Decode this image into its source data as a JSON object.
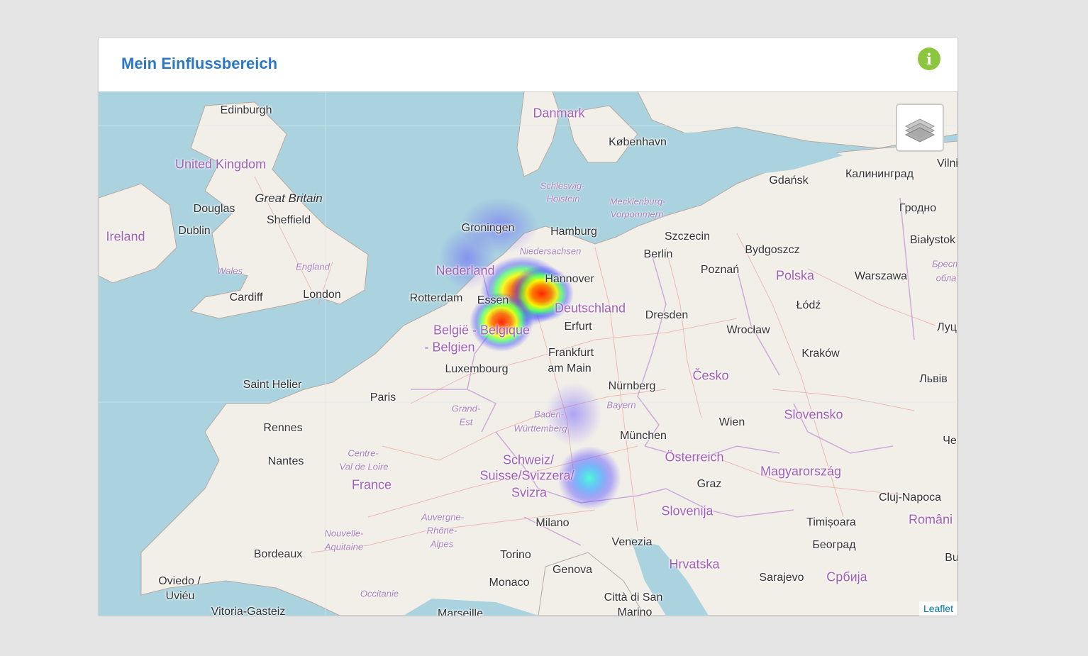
{
  "widget": {
    "title": "Mein Einflussbereich",
    "info_icon": "info-circle-icon",
    "accent_color": "#2b78c5",
    "info_color": "#8cc63f"
  },
  "map": {
    "layers_icon": "layers-icon",
    "attribution": "Leaflet",
    "labels": [
      {
        "name": "label-edinburgh",
        "text": "Edinburgh",
        "kind": "city"
      },
      {
        "name": "label-united-kingdom",
        "text": "United Kingdom",
        "kind": "country"
      },
      {
        "name": "label-great-britain",
        "text": "Great Britain",
        "kind": "island"
      },
      {
        "name": "label-douglas",
        "text": "Douglas",
        "kind": "city"
      },
      {
        "name": "label-sheffield",
        "text": "Sheffield",
        "kind": "city"
      },
      {
        "name": "label-ireland",
        "text": "Ireland",
        "kind": "country"
      },
      {
        "name": "label-dublin",
        "text": "Dublin",
        "kind": "city"
      },
      {
        "name": "label-wales",
        "text": "Wales",
        "kind": "region"
      },
      {
        "name": "label-england",
        "text": "England",
        "kind": "region"
      },
      {
        "name": "label-cardiff",
        "text": "Cardiff",
        "kind": "city"
      },
      {
        "name": "label-london",
        "text": "London",
        "kind": "city"
      },
      {
        "name": "label-danmark",
        "text": "Danmark",
        "kind": "country"
      },
      {
        "name": "label-kobenhavn",
        "text": "København",
        "kind": "city"
      },
      {
        "name": "label-schleswig-holstein-1",
        "text": "Schleswig-",
        "kind": "region"
      },
      {
        "name": "label-schleswig-holstein-2",
        "text": "Holstein",
        "kind": "region"
      },
      {
        "name": "label-mecklenburg-1",
        "text": "Mecklenburg-",
        "kind": "region"
      },
      {
        "name": "label-mecklenburg-2",
        "text": "Vorpommern",
        "kind": "region"
      },
      {
        "name": "label-gdansk",
        "text": "Gdańsk",
        "kind": "city"
      },
      {
        "name": "label-kaliningrad",
        "text": "Калининград",
        "kind": "city"
      },
      {
        "name": "label-vilnius",
        "text": "Vilni",
        "kind": "city"
      },
      {
        "name": "label-groningen",
        "text": "Groningen",
        "kind": "city"
      },
      {
        "name": "label-hamburg",
        "text": "Hamburg",
        "kind": "city"
      },
      {
        "name": "label-szczecin",
        "text": "Szczecin",
        "kind": "city"
      },
      {
        "name": "label-grodno",
        "text": "Гродно",
        "kind": "city"
      },
      {
        "name": "label-bialystok",
        "text": "Białystok",
        "kind": "city"
      },
      {
        "name": "label-niedersachsen",
        "text": "Niedersachsen",
        "kind": "region"
      },
      {
        "name": "label-berlin",
        "text": "Berlin",
        "kind": "city"
      },
      {
        "name": "label-bydgoszcz",
        "text": "Bydgoszcz",
        "kind": "city"
      },
      {
        "name": "label-nederland",
        "text": "Nederland",
        "kind": "country"
      },
      {
        "name": "label-hannover",
        "text": "Hannover",
        "kind": "city"
      },
      {
        "name": "label-poznan",
        "text": "Poznań",
        "kind": "city"
      },
      {
        "name": "label-polska",
        "text": "Polska",
        "kind": "country"
      },
      {
        "name": "label-warszawa",
        "text": "Warszawa",
        "kind": "city"
      },
      {
        "name": "label-brest-1",
        "text": "Брест",
        "kind": "region"
      },
      {
        "name": "label-brest-2",
        "text": "обла",
        "kind": "region"
      },
      {
        "name": "label-rotterdam",
        "text": "Rotterdam",
        "kind": "city"
      },
      {
        "name": "label-essen",
        "text": "Essen",
        "kind": "city"
      },
      {
        "name": "label-deutschland",
        "text": "Deutschland",
        "kind": "country"
      },
      {
        "name": "label-dresden",
        "text": "Dresden",
        "kind": "city"
      },
      {
        "name": "label-lodz",
        "text": "Łódź",
        "kind": "city"
      },
      {
        "name": "label-belgie",
        "text": "België - Belgique",
        "kind": "country"
      },
      {
        "name": "label-belgien",
        "text": "- Belgien",
        "kind": "country"
      },
      {
        "name": "label-erfurt",
        "text": "Erfurt",
        "kind": "city"
      },
      {
        "name": "label-wroclaw",
        "text": "Wrocław",
        "kind": "city"
      },
      {
        "name": "label-lutsk",
        "text": "Луц",
        "kind": "city"
      },
      {
        "name": "label-frankfurt-1",
        "text": "Frankfurt",
        "kind": "city"
      },
      {
        "name": "label-frankfurt-2",
        "text": "am Main",
        "kind": "city"
      },
      {
        "name": "label-krakow",
        "text": "Kraków",
        "kind": "city"
      },
      {
        "name": "label-luxembourg",
        "text": "Luxembourg",
        "kind": "city"
      },
      {
        "name": "label-cesko",
        "text": "Česko",
        "kind": "country"
      },
      {
        "name": "label-lviv",
        "text": "Львів",
        "kind": "city"
      },
      {
        "name": "label-saint-helier",
        "text": "Saint Helier",
        "kind": "city"
      },
      {
        "name": "label-nurnberg",
        "text": "Nürnberg",
        "kind": "city"
      },
      {
        "name": "label-paris",
        "text": "Paris",
        "kind": "city"
      },
      {
        "name": "label-grand-est-1",
        "text": "Grand-",
        "kind": "region"
      },
      {
        "name": "label-grand-est-2",
        "text": "Est",
        "kind": "region"
      },
      {
        "name": "label-bayern",
        "text": "Bayern",
        "kind": "region"
      },
      {
        "name": "label-baden-1",
        "text": "Baden-",
        "kind": "region"
      },
      {
        "name": "label-baden-2",
        "text": "Württemberg",
        "kind": "region"
      },
      {
        "name": "label-slovensko",
        "text": "Slovensko",
        "kind": "country"
      },
      {
        "name": "label-wien",
        "text": "Wien",
        "kind": "city"
      },
      {
        "name": "label-rennes",
        "text": "Rennes",
        "kind": "city"
      },
      {
        "name": "label-munchen",
        "text": "München",
        "kind": "city"
      },
      {
        "name": "label-che",
        "text": "Че",
        "kind": "city"
      },
      {
        "name": "label-centre-1",
        "text": "Centre-",
        "kind": "region"
      },
      {
        "name": "label-centre-2",
        "text": "Val de Loire",
        "kind": "region"
      },
      {
        "name": "label-schweiz-1",
        "text": "Schweiz/",
        "kind": "country"
      },
      {
        "name": "label-schweiz-2",
        "text": "Suisse/Svizzera/",
        "kind": "country"
      },
      {
        "name": "label-schweiz-3",
        "text": "Svizra",
        "kind": "country"
      },
      {
        "name": "label-osterreich",
        "text": "Österreich",
        "kind": "country"
      },
      {
        "name": "label-nantes",
        "text": "Nantes",
        "kind": "city"
      },
      {
        "name": "label-magyarorszag",
        "text": "Magyarország",
        "kind": "country"
      },
      {
        "name": "label-france",
        "text": "France",
        "kind": "country"
      },
      {
        "name": "label-graz",
        "text": "Graz",
        "kind": "city"
      },
      {
        "name": "label-cluj",
        "text": "Cluj-Napoca",
        "kind": "city"
      },
      {
        "name": "label-slovenija",
        "text": "Slovenija",
        "kind": "country"
      },
      {
        "name": "label-auvergne-1",
        "text": "Auvergne-",
        "kind": "region"
      },
      {
        "name": "label-auvergne-2",
        "text": "Rhône-",
        "kind": "region"
      },
      {
        "name": "label-auvergne-3",
        "text": "Alpes",
        "kind": "region"
      },
      {
        "name": "label-milano",
        "text": "Milano",
        "kind": "city"
      },
      {
        "name": "label-timisoara",
        "text": "Timișoara",
        "kind": "city"
      },
      {
        "name": "label-romania",
        "text": "Români",
        "kind": "country"
      },
      {
        "name": "label-nouvelle-1",
        "text": "Nouvelle-",
        "kind": "region"
      },
      {
        "name": "label-nouvelle-2",
        "text": "Aquitaine",
        "kind": "region"
      },
      {
        "name": "label-venezia",
        "text": "Venezia",
        "kind": "city"
      },
      {
        "name": "label-beograd",
        "text": "Београд",
        "kind": "city"
      },
      {
        "name": "label-bordeaux",
        "text": "Bordeaux",
        "kind": "city"
      },
      {
        "name": "label-torino",
        "text": "Torino",
        "kind": "city"
      },
      {
        "name": "label-hrvatska",
        "text": "Hrvatska",
        "kind": "country"
      },
      {
        "name": "label-bu",
        "text": "Bu",
        "kind": "city"
      },
      {
        "name": "label-genova",
        "text": "Genova",
        "kind": "city"
      },
      {
        "name": "label-sarajevo",
        "text": "Sarajevo",
        "kind": "city"
      },
      {
        "name": "label-srbija",
        "text": "Србија",
        "kind": "country"
      },
      {
        "name": "label-oviedo-1",
        "text": "Oviedo /",
        "kind": "city"
      },
      {
        "name": "label-oviedo-2",
        "text": "Uviéu",
        "kind": "city"
      },
      {
        "name": "label-monaco",
        "text": "Monaco",
        "kind": "city"
      },
      {
        "name": "label-occitanie",
        "text": "Occitanie",
        "kind": "region"
      },
      {
        "name": "label-citta-1",
        "text": "Città di San",
        "kind": "city"
      },
      {
        "name": "label-citta-2",
        "text": "Marino",
        "kind": "city"
      },
      {
        "name": "label-vitoria",
        "text": "Vitoria-Gasteiz",
        "kind": "city"
      },
      {
        "name": "label-marseille",
        "text": "Marseille",
        "kind": "city"
      }
    ],
    "heatmap_points": [
      {
        "name": "heat-spot-ruhr",
        "intensity": 1.0
      },
      {
        "name": "heat-spot-muenster",
        "intensity": 1.0
      },
      {
        "name": "heat-spot-cologne",
        "intensity": 0.85
      },
      {
        "name": "heat-spot-netherlands",
        "intensity": 0.25
      },
      {
        "name": "heat-spot-bodensee",
        "intensity": 0.55
      },
      {
        "name": "heat-spot-stuttgart",
        "intensity": 0.2
      }
    ]
  }
}
